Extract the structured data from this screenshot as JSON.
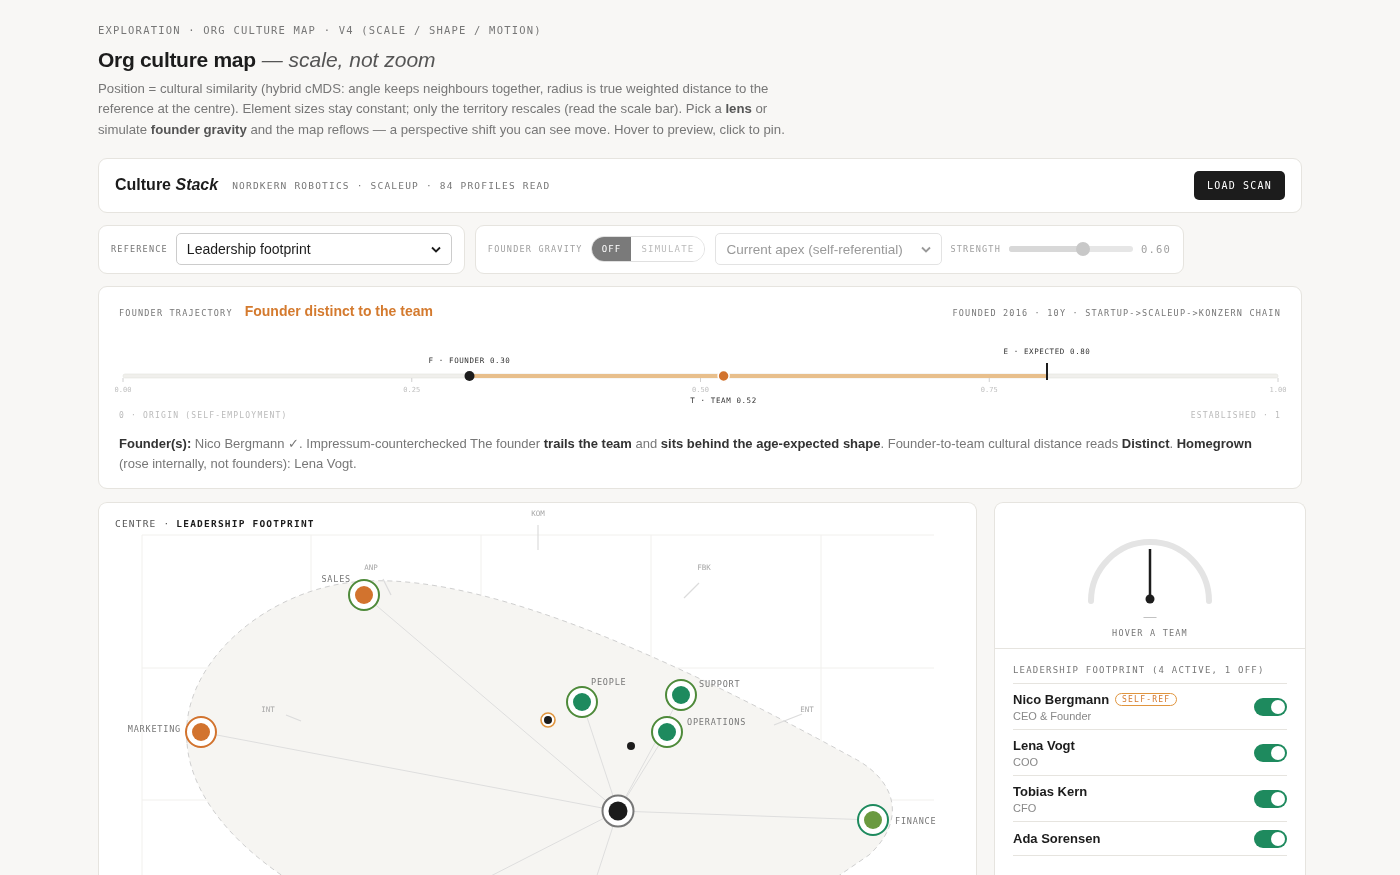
{
  "breadcrumb": "EXPLORATION · ORG CULTURE MAP · V4 (SCALE / SHAPE / MOTION)",
  "title": "Org culture map",
  "subtitle": "— scale, not zoom",
  "description": "Position = cultural similarity (hybrid cMDS: angle keeps neighbours together, radius is true weighted distance to the reference at the centre). Element sizes stay constant; only the territory rescales (read the scale bar). Pick a **lens** or simulate **founder gravity** and the map reflows — a perspective shift you can see move. Hover to preview, click to pin.",
  "app_bar": {
    "brand": "Culture *Stack*",
    "meta": "NORDKERN ROBOTICS · SCALEUP · 84 PROFILES READ",
    "button": "LOAD SCAN"
  },
  "reference": {
    "label": "REFERENCE",
    "value": "Leadership footprint"
  },
  "gravity": {
    "disabled": true,
    "label": "FOUNDER GRAVITY",
    "modes": [
      {
        "label": "OFF",
        "selected": true
      },
      {
        "label": "SIMULATE",
        "selected": false
      }
    ],
    "apex": "Current apex (self-referential)",
    "strength_label": "STRENGTH",
    "level": 0.6,
    "reading": "0.60"
  },
  "trajectory": {
    "label": "FOUNDER TRAJECTORY",
    "verdict": "Founder distinct to the team",
    "meta": "FOUNDED 2016 · 10Y · STARTUP->SCALEUP->KONZERN CHAIN",
    "markers": [
      {
        "kind": "founder",
        "label": "F · FOUNDER 0.30",
        "level": 0.3
      },
      {
        "kind": "team",
        "label": "T · TEAM 0.52",
        "level": 0.52
      },
      {
        "kind": "expected",
        "label": "E · EXPECTED 0.80",
        "level": 0.8
      }
    ],
    "ticks": [
      "0.00",
      "0.25",
      "0.50",
      "0.75",
      "1.00"
    ],
    "origin": "0 · ORIGIN (SELF-EMPLOYMENT)",
    "end": "ESTABLISHED · 1",
    "summary": "**Founder(s):** Nico Bergmann ✓. Impressum-counterchecked The founder **trails the team** and **sits behind the age-expected shape**. Founder-to-team cultural distance reads **Distinct**. **Homegrown** (rose internally, not founders): Lena Vogt."
  },
  "map": {
    "caption": "CENTRE ·",
    "reference": "LEADERSHIP FOOTPRINT",
    "axes": [
      {
        "label": "KOM"
      },
      {
        "label": "ANP"
      },
      {
        "label": "FBK"
      },
      {
        "label": "INT"
      },
      {
        "label": "ENT"
      }
    ],
    "nodes": [
      {
        "kind": "team",
        "label": "SALES",
        "ring": {
          "color": "#4e8a3a"
        },
        "color": "#d2732e"
      },
      {
        "kind": "team",
        "label": "MARKETING",
        "ring": {
          "color": "#d2732e"
        },
        "color": "#d2732e"
      },
      {
        "kind": "team",
        "label": "PEOPLE",
        "ring": {
          "color": "#4e8a3a"
        },
        "color": "#1e8a5e"
      },
      {
        "kind": "team",
        "label": "SUPPORT",
        "ring": {
          "color": "#4e8a3a"
        },
        "color": "#1e8a5e"
      },
      {
        "kind": "team",
        "label": "OPERATIONS",
        "ring": {
          "color": "#4e8a3a"
        },
        "color": "#1e8a5e"
      },
      {
        "kind": "team",
        "label": "FINANCE",
        "ring": {
          "color": "#1e8a5e"
        },
        "color": "#6a9a40"
      },
      {
        "kind": "centre",
        "ring": {
          "color": "#777777"
        },
        "color": "#1c1c1c"
      },
      {
        "kind": "founder",
        "ring": {
          "color": "#e0953e"
        },
        "color": "#1c1c1c"
      },
      {
        "kind": "point",
        "color": "#1c1c1c"
      }
    ]
  },
  "gauge": {
    "reading": "—",
    "hint": "HOVER A TEAM"
  },
  "leaders": {
    "title": "LEADERSHIP FOOTPRINT (4 ACTIVE, 1 OFF)",
    "items": [
      {
        "name": "Nico Bergmann",
        "badge": "SELF-REF",
        "role": "CEO & Founder",
        "on": true
      },
      {
        "name": "Lena Vogt",
        "role": "COO",
        "on": true
      },
      {
        "name": "Tobias Kern",
        "role": "CFO",
        "on": true
      },
      {
        "name": "Ada Sorensen",
        "on": true
      }
    ]
  }
}
